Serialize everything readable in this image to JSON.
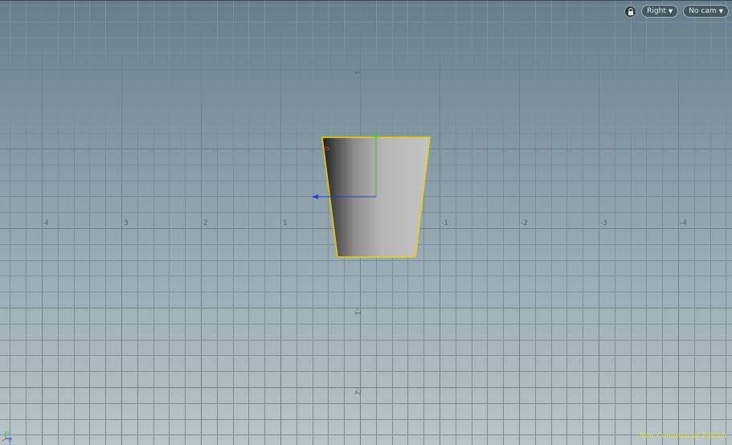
{
  "viewport": {
    "view_menu_label": "Right",
    "camera_menu_label": "No cam",
    "watermark": "Non-Commercial Edition",
    "horizontal_axis_labels": [
      "4",
      "3",
      "2",
      "1",
      "-1",
      "-2",
      "-3",
      "-4"
    ],
    "vertical_axis_labels": [
      "1",
      "-1",
      "-2"
    ],
    "colors": {
      "selection_outline": "#f0d000",
      "grid_line": "#7c8e97",
      "watermark": "#e6dc3c"
    },
    "icons": [
      "lock-icon",
      "chevron-down-icon",
      "axis-gnomon-icon",
      "transform-handle-icon"
    ]
  }
}
